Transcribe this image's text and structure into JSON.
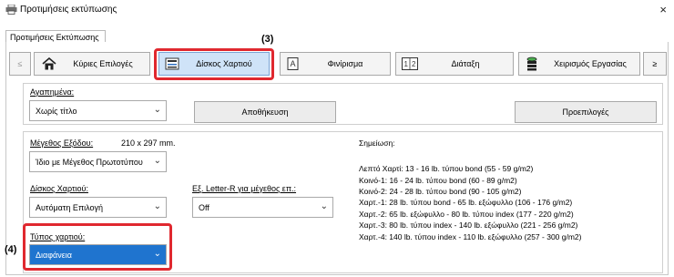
{
  "window": {
    "title": "Προτιμήσεις εκτύπωσης",
    "close_glyph": "×"
  },
  "tabs": {
    "active": "Προτιμήσεις Εκτύπωσης"
  },
  "categories": {
    "prev_glyph": "≤",
    "next_glyph": "≥",
    "items": [
      {
        "label": "Κύριες Επιλογές",
        "icon": "home-icon"
      },
      {
        "label": "Δίσκος Χαρτιού",
        "icon": "paper-tray-icon"
      },
      {
        "label": "Φινίρισμα",
        "icon": "finishing-icon"
      },
      {
        "label": "Διάταξη",
        "icon": "layout-icon"
      },
      {
        "label": "Χειρισμός Εργασίας",
        "icon": "job-handling-icon"
      }
    ],
    "selected_index": 1
  },
  "callouts": {
    "c3": "(3)",
    "c4": "(4)"
  },
  "favorites": {
    "label": "Αγαπημένα:",
    "value": "Χωρίς τίτλο",
    "save_button": "Αποθήκευση",
    "defaults_button": "Προεπιλογές"
  },
  "output_size": {
    "label": "Μέγεθος Εξόδου:",
    "dimension": "210 x 297 mm.",
    "value": "Ίδιο με Μέγεθος Πρωτοτύπου"
  },
  "paper_tray": {
    "label": "Δίσκος Χαρτιού:",
    "value": "Αυτόματη Επιλογή"
  },
  "letter_r": {
    "label": "Εξ. Letter-R για μέγεθος επ.:",
    "value": "Off"
  },
  "paper_type": {
    "label": "Τύπος χαρτιού:",
    "value": "Διαφάνεια"
  },
  "note": {
    "title": "Σημείωση:",
    "lines": [
      "Λεπτό Χαρτί: 13 - 16 lb. τύπου bond (55 - 59 g/m2)",
      "Κοινό-1: 16 - 24 lb. τύπου bond (60 - 89 g/m2)",
      "Κοινό-2: 24 - 28 lb. τύπου bond (90 - 105 g/m2)",
      "Χαρτ.-1: 28 lb. τύπου bond - 65 lb. εξώφυλλο (106 - 176 g/m2)",
      "Χαρτ.-2: 65 lb. εξώφυλλο - 80 lb. τύπου index (177 - 220 g/m2)",
      "Χαρτ.-3: 80 lb. τύπου index - 140 lb. εξώφυλλο (221 - 256 g/m2)",
      "Χαρτ.-4: 140 lb. τύπου index - 110 lb. εξώφυλλο (257 - 300 g/m2)"
    ]
  },
  "colors": {
    "highlight": "#e0282f",
    "selected_field": "#1f74cf",
    "selected_tab": "#cfe3f8"
  }
}
